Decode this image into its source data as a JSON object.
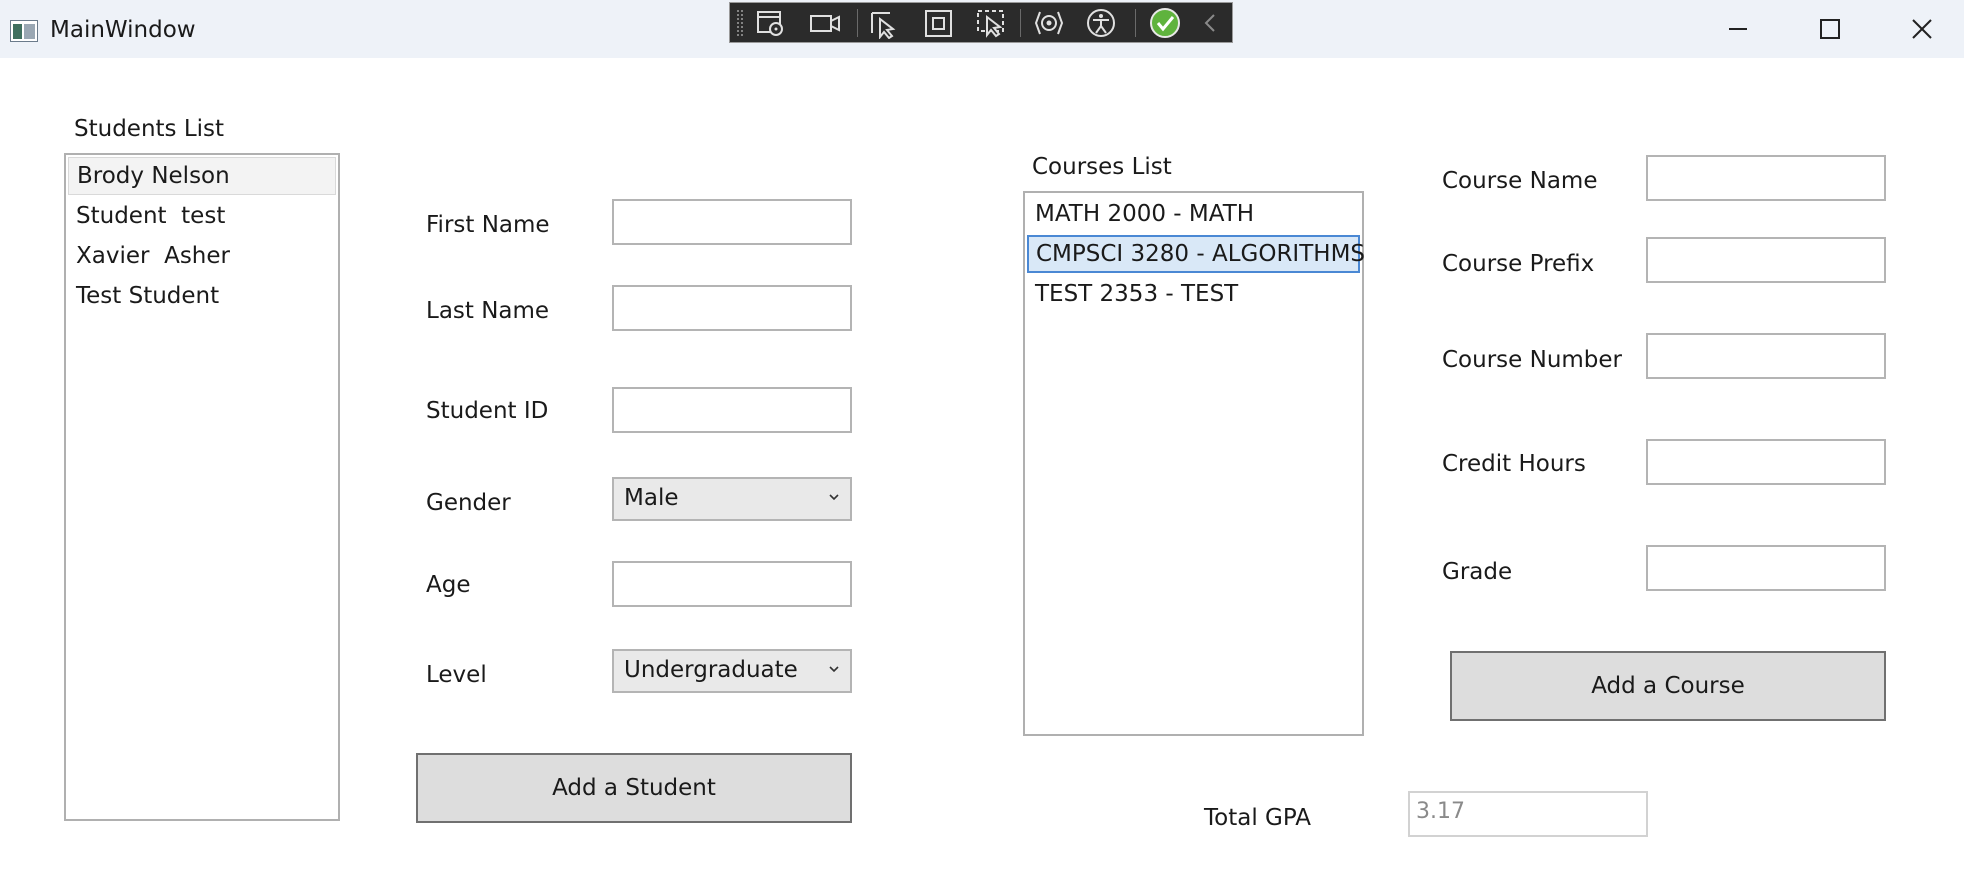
{
  "window": {
    "title": "MainWindow",
    "minimize_icon": "minimize-icon",
    "maximize_icon": "maximize-icon",
    "close_icon": "close-icon"
  },
  "debug_toolbar": {
    "icons": [
      "live-visual-tree-icon",
      "record-icon",
      "select-element-icon",
      "display-layout-adorners-icon",
      "track-focus-icon",
      "hot-reload-icon",
      "accessibility-checker-icon",
      "check-icon",
      "collapse-chevron-icon"
    ]
  },
  "students": {
    "title": "Students List",
    "items": [
      "Brody Nelson",
      "Student  test",
      "Xavier  Asher",
      "Test Student"
    ]
  },
  "student_form": {
    "first_name_label": "First Name",
    "first_name_value": "",
    "last_name_label": "Last Name",
    "last_name_value": "",
    "student_id_label": "Student ID",
    "student_id_value": "",
    "gender_label": "Gender",
    "gender_value": "Male",
    "age_label": "Age",
    "age_value": "",
    "level_label": "Level",
    "level_value": "Undergraduate",
    "add_button": "Add a Student"
  },
  "courses": {
    "title": "Courses List",
    "items": [
      "MATH 2000 - MATH",
      "CMPSCI 3280 - ALGORITHMS",
      "TEST 2353 - TEST"
    ],
    "selected": "CMPSCI 3280 - ALGORITHMS"
  },
  "course_form": {
    "course_name_label": "Course Name",
    "course_name_value": "",
    "course_prefix_label": "Course Prefix",
    "course_prefix_value": "",
    "course_number_label": "Course Number",
    "course_number_value": "",
    "credit_hours_label": "Credit Hours",
    "credit_hours_value": "",
    "grade_label": "Grade",
    "grade_value": "",
    "add_button": "Add a Course"
  },
  "gpa": {
    "label": "Total GPA",
    "value": "3.17"
  },
  "colors": {
    "titlebar": "#eef2f8",
    "selection": "#d9e8f7",
    "selection_border": "#4a88d4",
    "button": "#dddddd"
  }
}
